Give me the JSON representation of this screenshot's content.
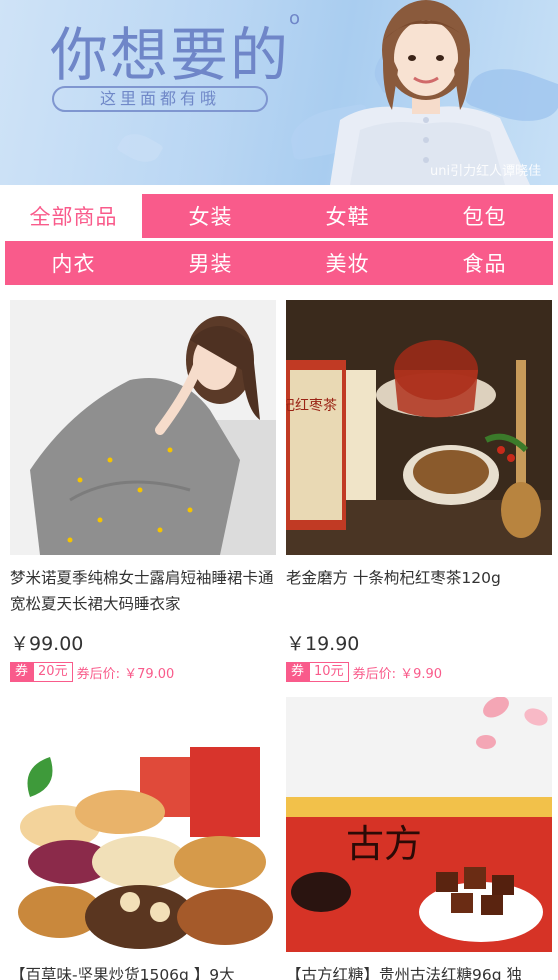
{
  "banner": {
    "title": "你想要的",
    "subtitle": "这里面都有哦",
    "caption": "uni引力红人谭晓佳"
  },
  "categories": [
    {
      "label": "全部商品",
      "active": true
    },
    {
      "label": "女装",
      "active": false
    },
    {
      "label": "女鞋",
      "active": false
    },
    {
      "label": "包包",
      "active": false
    },
    {
      "label": "内衣",
      "active": false
    },
    {
      "label": "男装",
      "active": false
    },
    {
      "label": "美妆",
      "active": false
    },
    {
      "label": "食品",
      "active": false
    }
  ],
  "products": [
    {
      "name": "梦米诺夏季纯棉女士露肩短袖睡裙卡通宽松夏天长裙大码睡衣家",
      "price": "￥99.00",
      "coupon_label": "券",
      "coupon_amount": "20元",
      "after_coupon": "券后价: ￥79.00"
    },
    {
      "name": "老金磨方 十条枸杞红枣茶120g",
      "price": "￥19.90",
      "coupon_label": "券",
      "coupon_amount": "10元",
      "after_coupon": "券后价: ￥9.90"
    },
    {
      "name": "【百草味-坚果炒货1506g 】9大",
      "price": "",
      "coupon_label": "",
      "coupon_amount": "",
      "after_coupon": ""
    },
    {
      "name": "【古方红糖】贵州古法红糖96g 独",
      "price": "",
      "coupon_label": "",
      "coupon_amount": "",
      "after_coupon": ""
    }
  ],
  "package_text": {
    "tea_box": "枸杞红枣茶",
    "tea_brand": "枸杞",
    "sugar_brand": "古方"
  }
}
